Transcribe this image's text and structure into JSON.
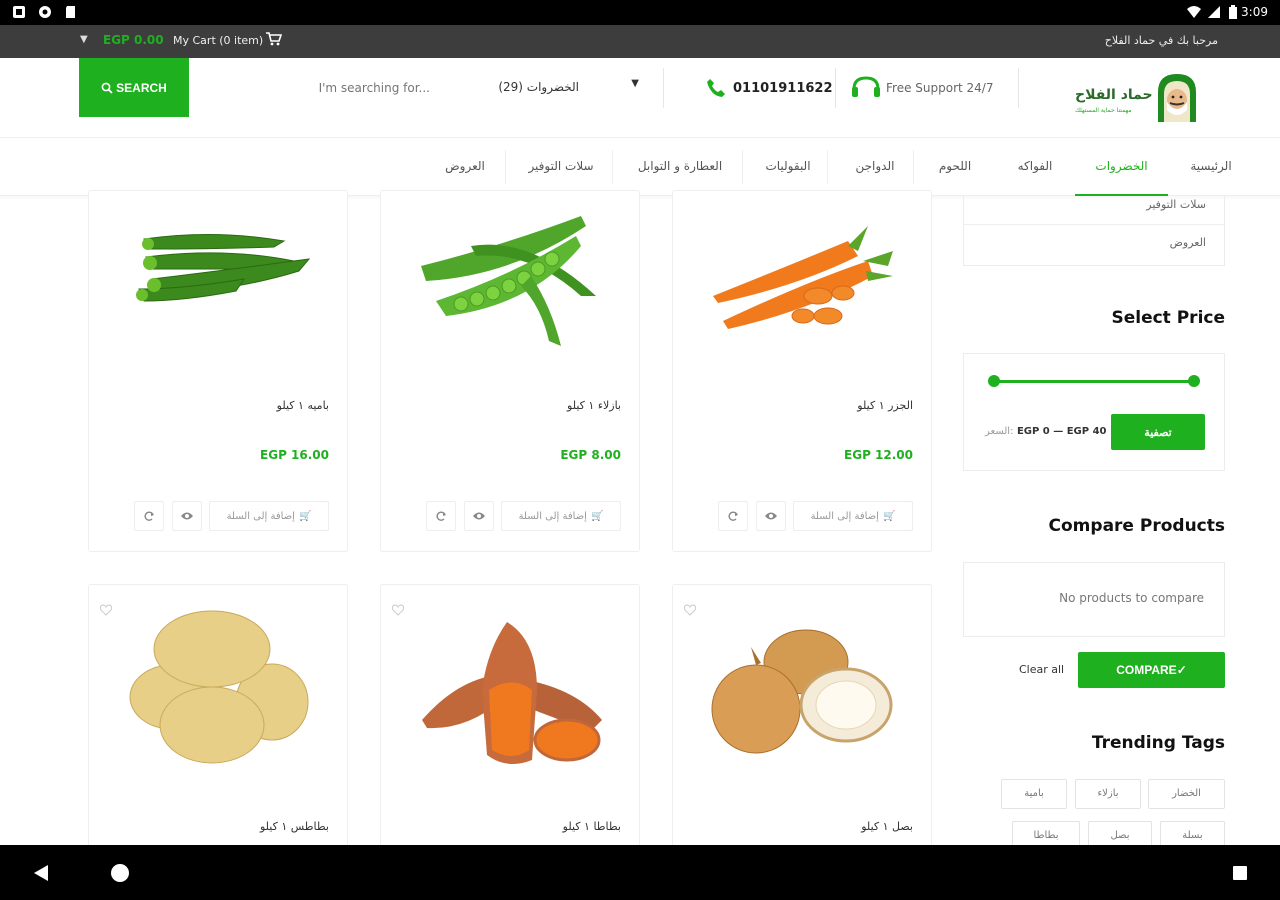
{
  "status_bar": {
    "time": "3:09",
    "left_icons": [
      "notification-icon",
      "settings-icon",
      "sd-card-icon"
    ],
    "right_icons": [
      "wifi-icon",
      "signal-icon",
      "battery-icon"
    ]
  },
  "topbar": {
    "cart_total": "EGP 0.00",
    "cart_label": "My Cart (0 item)",
    "welcome": "مرحبا بك في حماد الفلاح"
  },
  "header": {
    "search_button": "SEARCH",
    "search_placeholder": "I'm searching for...",
    "category": "الخضروات",
    "category_count": "(29)",
    "phone": "01101911622",
    "support": "Free Support 24/7",
    "logo_text": "حماد الفلاح",
    "logo_tagline": "مهمتنا حماية المستهلك"
  },
  "nav": {
    "items": [
      {
        "label": "الرئيسية",
        "active": false
      },
      {
        "label": "الخضروات",
        "active": true
      },
      {
        "label": "الفواكه",
        "active": false
      },
      {
        "label": "اللحوم",
        "active": false
      },
      {
        "label": "الدواجن",
        "active": false
      },
      {
        "label": "البقوليات",
        "active": false
      },
      {
        "label": "العطارة و التوابل",
        "active": false
      },
      {
        "label": "سلات التوفير",
        "active": false
      },
      {
        "label": "العروض",
        "active": false
      }
    ]
  },
  "sidebar": {
    "categories": [
      "سلات التوفير",
      "العروض"
    ],
    "price_title": "Select Price",
    "price_range": "EGP 0 — EGP 40",
    "price_label": "السعر:",
    "filter_button": "تصفية",
    "compare_title": "Compare Products",
    "compare_empty": "No products to compare",
    "clear_all": "Clear all",
    "compare_button": "COMPARE",
    "tags_title": "Trending Tags",
    "tags": [
      "الخضار",
      "بازلاء",
      "بامية",
      "بسلة",
      "بصل",
      "بطاطا"
    ]
  },
  "products": [
    {
      "name": "باميه ١ كيلو",
      "price": "EGP 16.00",
      "add_to_cart": "إضافة إلى السلة",
      "image": "okra"
    },
    {
      "name": "بازلاء ١ كيلو",
      "price": "EGP 8.00",
      "add_to_cart": "إضافة إلى السلة",
      "image": "peas"
    },
    {
      "name": "الجزر ١ كيلو",
      "price": "EGP 12.00",
      "add_to_cart": "إضافة إلى السلة",
      "image": "carrots"
    },
    {
      "name": "بطاطس ١ كيلو",
      "image": "potatoes"
    },
    {
      "name": "بطاطا ١ كيلو",
      "image": "sweet-potatoes"
    },
    {
      "name": "بصل ١ كيلو",
      "image": "onions"
    }
  ],
  "colors": {
    "accent": "#1fb01f",
    "topbar": "#3d3d3d"
  }
}
